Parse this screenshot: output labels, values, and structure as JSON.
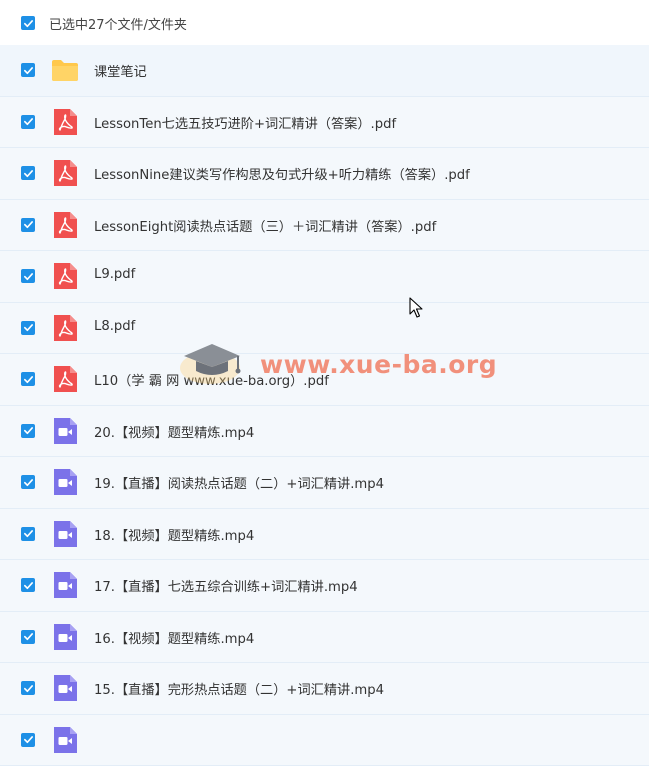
{
  "header": {
    "selection_text": "已选中27个文件/文件夹"
  },
  "files": [
    {
      "name": "课堂笔记",
      "type": "folder"
    },
    {
      "name": "LessonTen七选五技巧进阶+词汇精讲（答案）.pdf",
      "type": "pdf"
    },
    {
      "name": "LessonNine建议类写作构思及句式升级+听力精练（答案）.pdf",
      "type": "pdf"
    },
    {
      "name": "LessonEight阅读热点话题（三）＋词汇精讲（答案）.pdf",
      "type": "pdf"
    },
    {
      "name": "L9.pdf",
      "type": "pdf"
    },
    {
      "name": "L8.pdf",
      "type": "pdf"
    },
    {
      "name": "L10（学 霸 网 www.xue-ba.org）.pdf",
      "type": "pdf"
    },
    {
      "name": "20.【视频】题型精炼.mp4",
      "type": "video"
    },
    {
      "name": "19.【直播】阅读热点话题（二）+词汇精讲.mp4",
      "type": "video"
    },
    {
      "name": "18.【视频】题型精练.mp4",
      "type": "video"
    },
    {
      "name": "17.【直播】七选五综合训练+词汇精讲.mp4",
      "type": "video"
    },
    {
      "name": "16.【视频】题型精练.mp4",
      "type": "video"
    },
    {
      "name": "15.【直播】完形热点话题（二）+词汇精讲.mp4",
      "type": "video"
    },
    {
      "name": "",
      "type": "video"
    }
  ],
  "watermark": {
    "text": "www.xue-ba.org"
  },
  "colors": {
    "checkbox": "#1e90e6",
    "pdf": "#f0504f",
    "video": "#7b72e9",
    "folder": "#ffc84b"
  }
}
